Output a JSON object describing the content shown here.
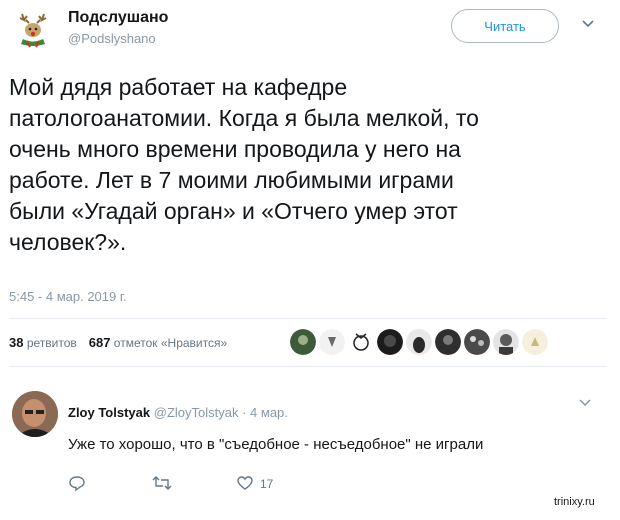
{
  "tweet": {
    "author_name": "Подслушано",
    "author_handle": "@Podslyshano",
    "follow_label": "Читать",
    "text_lines": [
      "Мой дядя работает на кафедре",
      "патологоанатомии. Когда я была мелкой, то",
      "очень много времени проводила у него на",
      "работе. Лет в 7 моими любимыми играми",
      "были «Угадай орган» и «Отчего умер этот",
      "человек?»."
    ],
    "timestamp": "5:45 - 4 мар. 2019 г.",
    "retweets_count": "38",
    "retweets_label": "ретвитов",
    "likes_count": "687",
    "likes_label": "отметок «Нравится»",
    "likers": [
      "liker-1-avatar",
      "liker-2-avatar",
      "liker-3-avatar",
      "liker-4-avatar",
      "liker-5-avatar",
      "liker-6-avatar",
      "liker-7-avatar",
      "liker-8-avatar",
      "liker-9-avatar"
    ]
  },
  "reply": {
    "author_name": "Zloy Tolstyak",
    "author_handle": "@ZloyTolstyak",
    "date": "· 4 мар.",
    "text": "Уже то хорошо, что в \"съедобное - несъедобное\" не играли",
    "actions": {
      "reply_icon": "reply-icon",
      "retweet_icon": "retweet-icon",
      "like_icon": "heart-icon",
      "like_count": "17"
    }
  },
  "watermark": "trinixy.ru",
  "colors": {
    "link": "#1b95e0",
    "muted": "#8899a6",
    "text": "#14171a",
    "divider": "#e6ecf0"
  }
}
